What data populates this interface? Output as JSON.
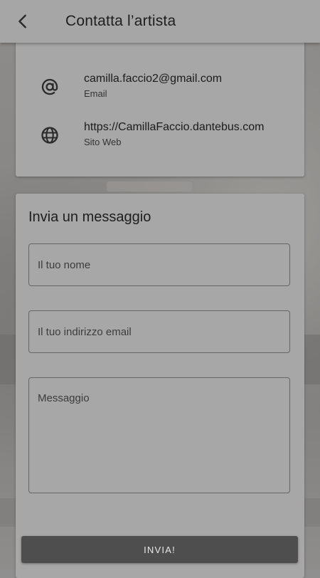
{
  "header": {
    "title": "Contatta l’artista",
    "back_icon": "chevron-left-icon"
  },
  "contact": {
    "email": {
      "value": "camilla.faccio2@gmail.com",
      "caption": "Email",
      "icon": "at-sign-icon"
    },
    "website": {
      "value": "https://CamillaFaccio.dantebus.com",
      "caption": "Sito Web",
      "icon": "globe-icon"
    }
  },
  "form": {
    "title": "Invia un messaggio",
    "name_placeholder": "Il tuo nome",
    "email_placeholder": "Il tuo indirizzo email",
    "message_placeholder": "Messaggio",
    "submit_label": "INVIA!"
  },
  "colors": {
    "overlay": "#a6a6a6",
    "button": "#4e4e4e",
    "button_text": "#e8e8e8"
  }
}
